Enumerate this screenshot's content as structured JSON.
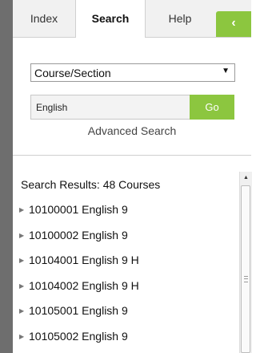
{
  "tabs": [
    {
      "label": "Index"
    },
    {
      "label": "Search"
    },
    {
      "label": "Help"
    }
  ],
  "collapse_button": {
    "glyph": "‹"
  },
  "search": {
    "type_selected": "Course/Section",
    "query_value": "English",
    "go_label": "Go",
    "advanced_label": "Advanced Search"
  },
  "results": {
    "header": "Search Results: 48 Courses",
    "items": [
      {
        "label": "10100001 English 9"
      },
      {
        "label": "10100002 English 9"
      },
      {
        "label": "10104001 English 9 H"
      },
      {
        "label": "10104002 English 9 H"
      },
      {
        "label": "10105001 English 9"
      },
      {
        "label": "10105002 English 9"
      }
    ]
  },
  "colors": {
    "accent": "#8cc63f",
    "frame": "#6e6e6e"
  }
}
